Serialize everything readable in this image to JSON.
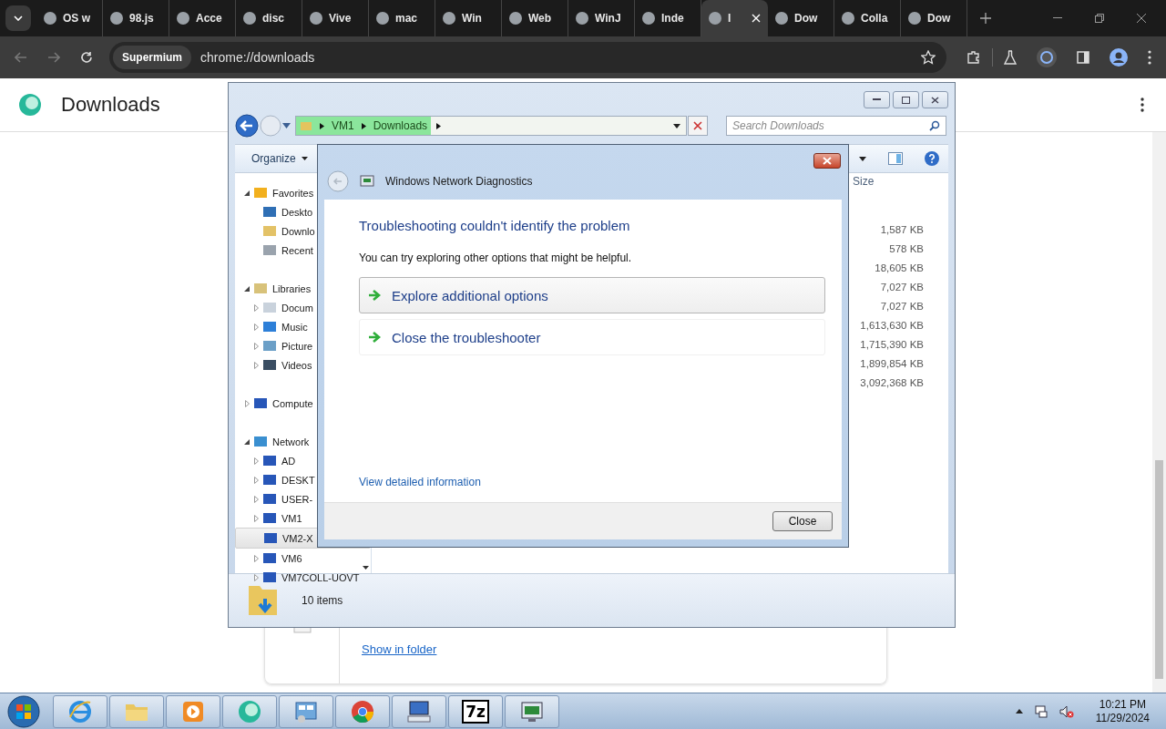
{
  "browser": {
    "tabs": [
      {
        "label": "OS w",
        "selected": false
      },
      {
        "label": "98.js",
        "selected": false
      },
      {
        "label": "Acce",
        "selected": false
      },
      {
        "label": "disc",
        "selected": false
      },
      {
        "label": "Vive",
        "selected": false
      },
      {
        "label": "mac",
        "selected": false
      },
      {
        "label": "Win",
        "selected": false
      },
      {
        "label": "Web",
        "selected": false
      },
      {
        "label": "WinJ",
        "selected": false
      },
      {
        "label": "Inde",
        "selected": false
      },
      {
        "label": "I",
        "selected": true
      },
      {
        "label": "Dow",
        "selected": false
      },
      {
        "label": "Colla",
        "selected": false
      },
      {
        "label": "Dow",
        "selected": false
      }
    ],
    "omnibox": {
      "chip": "Supermium",
      "url": "chrome://downloads"
    }
  },
  "page": {
    "title": "Downloads",
    "link": "Show in folder"
  },
  "explorer": {
    "breadcrumb": [
      "VM1",
      "Downloads"
    ],
    "search_placeholder": "Search Downloads",
    "organize": "Organize",
    "column": "Size",
    "nav_tree": [
      {
        "label": "Favorites",
        "kind": "star",
        "expanded": true,
        "selected": false,
        "children": [
          {
            "label": "Deskto",
            "kind": "desktop",
            "selected": false
          },
          {
            "label": "Downlo",
            "kind": "downloads",
            "selected": false
          },
          {
            "label": "Recent",
            "kind": "recent",
            "selected": false
          }
        ]
      },
      {
        "label": "Libraries",
        "kind": "library",
        "expanded": true,
        "selected": false,
        "children": [
          {
            "label": "Docum",
            "kind": "document",
            "expanded": false,
            "selected": false
          },
          {
            "label": "Music",
            "kind": "music",
            "expanded": false,
            "selected": false
          },
          {
            "label": "Picture",
            "kind": "picture",
            "expanded": false,
            "selected": false
          },
          {
            "label": "Videos",
            "kind": "video",
            "expanded": false,
            "selected": false
          }
        ]
      },
      {
        "label": "Compute",
        "kind": "computer",
        "expanded": false,
        "selected": false
      },
      {
        "label": "Network",
        "kind": "network",
        "expanded": true,
        "selected": false,
        "children": [
          {
            "label": "AD",
            "kind": "computer",
            "expanded": false,
            "selected": false
          },
          {
            "label": "DESKT",
            "kind": "computer",
            "expanded": false,
            "selected": false
          },
          {
            "label": "USER-",
            "kind": "computer",
            "expanded": false,
            "selected": false
          },
          {
            "label": "VM1",
            "kind": "computer",
            "expanded": false,
            "selected": false
          },
          {
            "label": "VM2-X",
            "kind": "computer",
            "selected": true
          },
          {
            "label": "VM6",
            "kind": "computer",
            "expanded": false,
            "selected": false
          },
          {
            "label": "VM7COLL-UOVT",
            "kind": "computer",
            "expanded": false,
            "selected": false
          }
        ]
      }
    ],
    "sizes": [
      "1,587 KB",
      "578 KB",
      "18,605 KB",
      "7,027 KB",
      "7,027 KB",
      "1,613,630 KB",
      "1,715,390 KB",
      "1,899,854 KB",
      "3,092,368 KB"
    ],
    "status": "10 items"
  },
  "dialog": {
    "title": "Windows Network Diagnostics",
    "heading": "Troubleshooting couldn't identify the problem",
    "text": "You can try exploring other options that might be helpful.",
    "options": [
      {
        "label": "Explore additional options",
        "selected": true
      },
      {
        "label": "Close the troubleshooter",
        "selected": false
      }
    ],
    "details_link": "View detailed information",
    "close": "Close"
  },
  "taskbar": {
    "apps": [
      {
        "kind": "ie"
      },
      {
        "kind": "folder"
      },
      {
        "kind": "media"
      },
      {
        "kind": "supermium"
      },
      {
        "kind": "control"
      },
      {
        "kind": "chrome"
      },
      {
        "kind": "network"
      },
      {
        "kind": "archive",
        "label": "7z"
      },
      {
        "kind": "diagnostics"
      }
    ],
    "time": "10:21 PM",
    "date": "11/29/2024"
  }
}
